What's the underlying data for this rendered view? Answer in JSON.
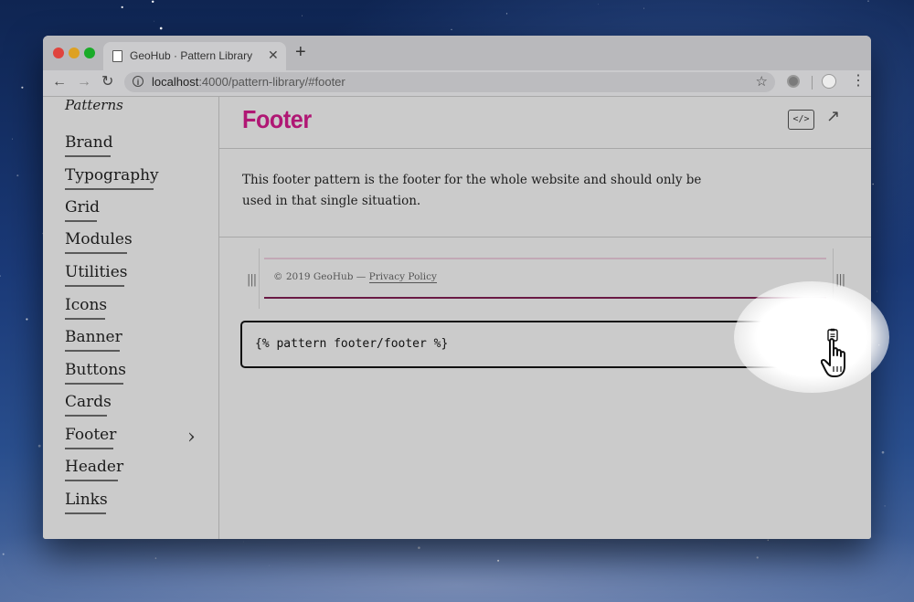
{
  "browser": {
    "tab_title": "GeoHub · Pattern Library",
    "tab_close": "✕",
    "new_tab": "+",
    "url_host": "localhost",
    "url_rest": ":4000/pattern-library/#footer",
    "back": "←",
    "forward": "→",
    "reload": "↻",
    "bookmark": "☆",
    "menu": "⋮",
    "info": "i"
  },
  "sidebar": {
    "heading": "Patterns",
    "items": [
      {
        "label": "Brand"
      },
      {
        "label": "Typography"
      },
      {
        "label": "Grid"
      },
      {
        "label": "Modules"
      },
      {
        "label": "Utilities"
      },
      {
        "label": "Icons"
      },
      {
        "label": "Banner"
      },
      {
        "label": "Buttons"
      },
      {
        "label": "Cards"
      },
      {
        "label": "Footer",
        "active": true
      },
      {
        "label": "Header"
      },
      {
        "label": "Links"
      }
    ],
    "active_chevron": "›"
  },
  "main": {
    "title": "Footer",
    "code_button": "</>",
    "open_button": "↗",
    "description": "This footer pattern is the footer for the whole website and should only be used in that single situation.",
    "preview": {
      "copyright": "© 2019 GeoHub — ",
      "privacy_link": "Privacy Policy",
      "grip": "|||"
    },
    "code_snippet": "{% pattern footer/footer %}"
  },
  "colors": {
    "title_accent": "#b01774",
    "footer_bar": "#6a1a44"
  },
  "icons": [
    "info-icon",
    "star-icon",
    "extension-icon",
    "profile-icon",
    "code-icon",
    "external-link-icon",
    "clipboard-icon",
    "hand-cursor-icon",
    "chevron-right-icon",
    "grip-icon"
  ]
}
